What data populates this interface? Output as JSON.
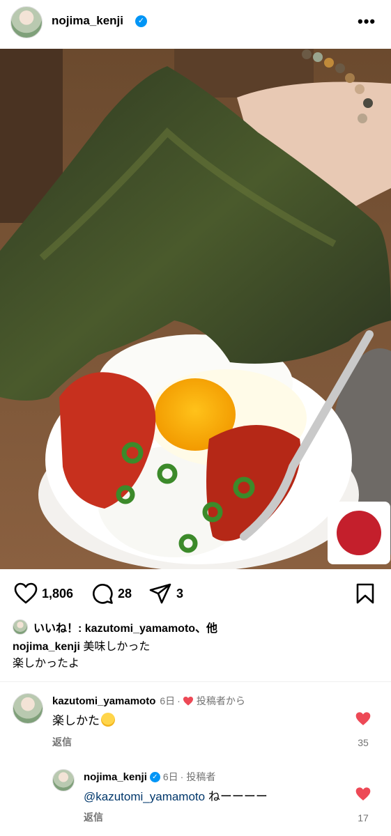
{
  "post": {
    "username": "nojima_kenji",
    "more": "•••"
  },
  "actions": {
    "likes": "1,806",
    "comments": "28",
    "shares": "3"
  },
  "liked_by": "いいね！: kazutomi_yamamoto、他",
  "caption": {
    "username": "nojima_kenji",
    "line1": "美味しかった",
    "line2": "楽しかったよ"
  },
  "comments": [
    {
      "username": "kazutomi_yamamoto",
      "time": "6日",
      "sep": "·",
      "badge": "投稿者から",
      "text": "楽しかた",
      "reply": "返信",
      "likes": "35"
    },
    {
      "username": "nojima_kenji",
      "time": "6日",
      "sep": "·",
      "badge": "投稿者",
      "mention": "@kazutomi_yamamoto",
      "text": "ねーーーー",
      "reply": "返信",
      "likes": "17"
    }
  ],
  "colors": {
    "verified": "#0095f6",
    "heart_red": "#ed4956",
    "mention": "#00376b",
    "meta": "#737373"
  }
}
